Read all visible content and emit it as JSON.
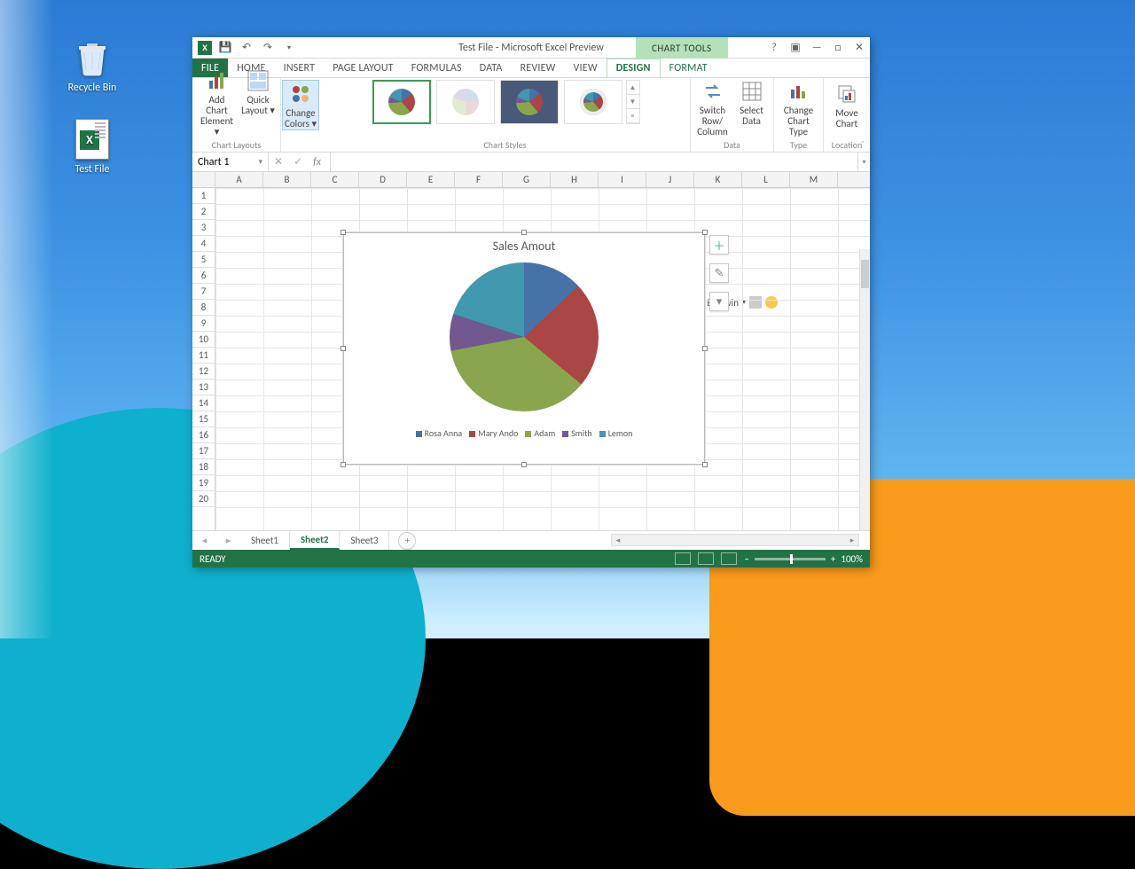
{
  "desktop": {
    "recycle_label": "Recycle Bin",
    "testfile_label": "Test File"
  },
  "window": {
    "title": "Test File - Microsoft Excel Preview",
    "chart_tools": "CHART TOOLS",
    "user": "Adam Baldwin"
  },
  "tabs": {
    "file": "FILE",
    "home": "HOME",
    "insert": "INSERT",
    "pagelayout": "PAGE LAYOUT",
    "formulas": "FORMULAS",
    "data": "DATA",
    "review": "REVIEW",
    "view": "VIEW",
    "design": "DESIGN",
    "format": "FORMAT"
  },
  "ribbon": {
    "add_el": "Add Chart Element ▾",
    "quick": "Quick Layout ▾",
    "colors": "Change Colors ▾",
    "layouts_label": "Chart Layouts",
    "styles_label": "Chart Styles",
    "switch": "Switch Row/ Column",
    "select": "Select Data",
    "data_label": "Data",
    "chtype": "Change Chart Type",
    "type_label": "Type",
    "move": "Move Chart",
    "loc_label": "Location"
  },
  "fx": {
    "namebox": "Chart 1",
    "fxlabel": "fx"
  },
  "cols": [
    "A",
    "B",
    "C",
    "D",
    "E",
    "F",
    "G",
    "H",
    "I",
    "J",
    "K",
    "L",
    "M"
  ],
  "rows": [
    "1",
    "2",
    "3",
    "4",
    "5",
    "6",
    "7",
    "8",
    "9",
    "10",
    "11",
    "12",
    "13",
    "14",
    "15",
    "16",
    "17",
    "18",
    "19",
    "20"
  ],
  "chart": {
    "title": "Sales Amout",
    "legend": [
      "Rosa Anna",
      "Mary Ando",
      "Adam",
      "Smith",
      "Lemon"
    ]
  },
  "sheets": {
    "s1": "Sheet1",
    "s2": "Sheet2",
    "s3": "Sheet3"
  },
  "status": {
    "ready": "READY",
    "zoom": "100%"
  },
  "chart_data": {
    "type": "pie",
    "title": "Sales Amout",
    "series": [
      {
        "name": "Rosa Anna",
        "value": 13,
        "color": "#4573a7"
      },
      {
        "name": "Mary Ando",
        "value": 23,
        "color": "#aa4644"
      },
      {
        "name": "Adam",
        "value": 36,
        "color": "#89a54e"
      },
      {
        "name": "Smith",
        "value": 8,
        "color": "#71588f"
      },
      {
        "name": "Lemon",
        "value": 20,
        "color": "#4298af"
      }
    ],
    "legend_position": "bottom"
  }
}
